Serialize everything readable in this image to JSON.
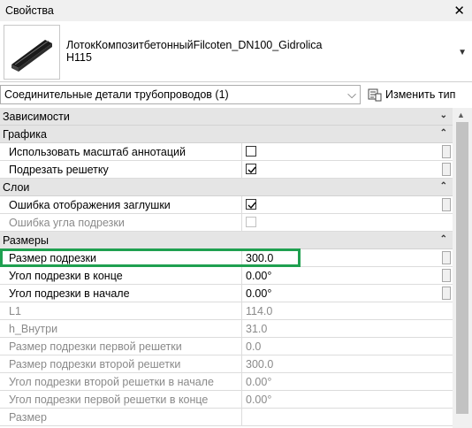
{
  "window": {
    "title": "Свойства",
    "close_glyph": "✕"
  },
  "type_selector": {
    "family_name": "ЛотокКомпозитбетонныйFilcoten_DN100_Gidrolica",
    "type_name": "H115",
    "dropdown_glyph": "▼"
  },
  "category_selector": {
    "label": "Соединительные детали трубопроводов (1)",
    "chevron": "⌵"
  },
  "edit_type": {
    "label": "Изменить тип"
  },
  "collapse_glyph_expanded": "⌃",
  "collapse_glyph_collapsed": "⌄",
  "groups": [
    {
      "label": "Зависимости",
      "collapsed": true
    },
    {
      "label": "Графика",
      "collapsed": false
    },
    {
      "label": "Слои",
      "collapsed": false
    },
    {
      "label": "Размеры",
      "collapsed": false
    }
  ],
  "properties": {
    "graphics": [
      {
        "name": "Использовать масштаб аннотаций",
        "checked": false
      },
      {
        "name": "Подрезать решетку",
        "checked": true
      }
    ],
    "layers": [
      {
        "name": "Ошибка отображения заглушки",
        "checked": true
      },
      {
        "name": "Ошибка угла подрезки",
        "checked": false,
        "disabled": true
      }
    ],
    "dimensions": [
      {
        "name": "Размер подрезки",
        "value": "300.0",
        "highlighted": true
      },
      {
        "name": "Угол подрезки в конце",
        "value": "0.00°"
      },
      {
        "name": "Угол подрезки в начале",
        "value": "0.00°"
      },
      {
        "name": "L1",
        "value": "114.0",
        "disabled": true
      },
      {
        "name": "h_Внутри",
        "value": "31.0",
        "disabled": true
      },
      {
        "name": "Размер подрезки первой решетки",
        "value": "0.0",
        "disabled": true
      },
      {
        "name": "Размер подрезки второй решетки",
        "value": "300.0",
        "disabled": true
      },
      {
        "name": "Угол подрезки второй решетки в начале",
        "value": "0.00°",
        "disabled": true
      },
      {
        "name": "Угол подрезки первой решетки в конце",
        "value": "0.00°",
        "disabled": true
      },
      {
        "name": "Размер",
        "value": "",
        "disabled": true
      }
    ]
  },
  "colors": {
    "highlight": "#1fa050",
    "group_bg": "#e5e5e5",
    "disabled_text": "#8a8a8a"
  }
}
